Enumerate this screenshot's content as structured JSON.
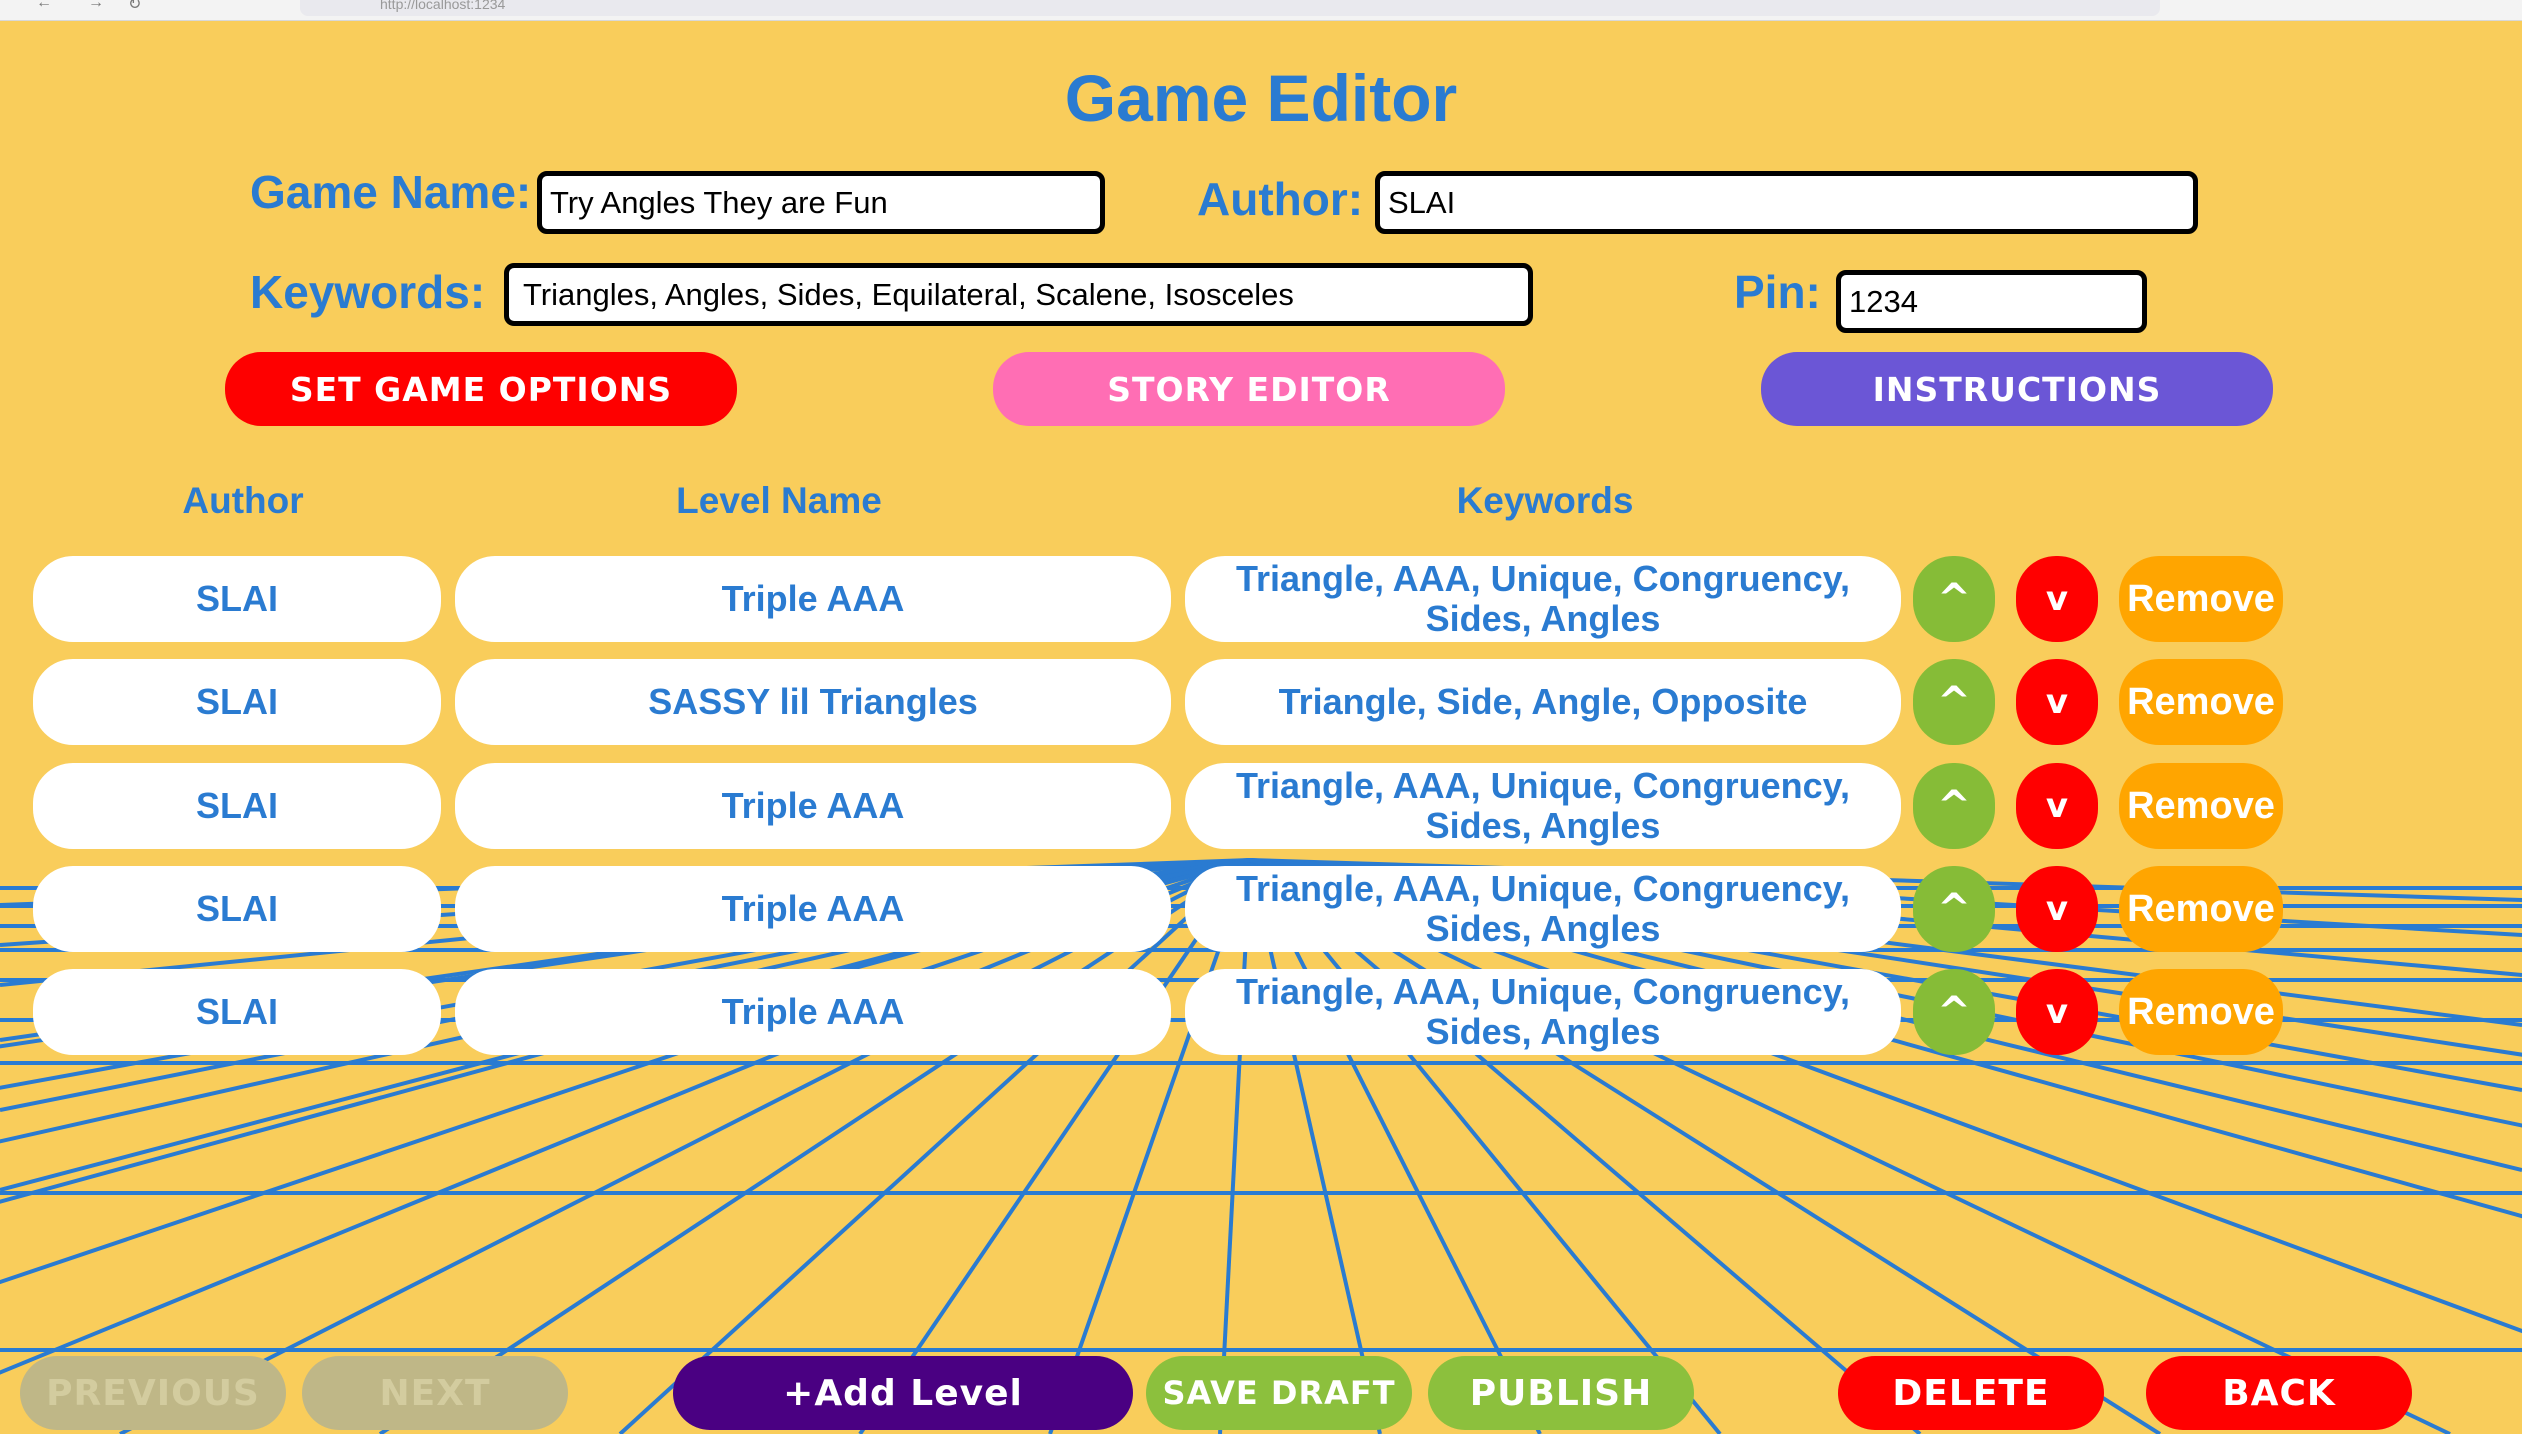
{
  "browser": {
    "url": "http://localhost:1234"
  },
  "page": {
    "title": "Game Editor"
  },
  "form": {
    "game_name_label": "Game Name:",
    "game_name_value": "Try Angles They are Fun",
    "author_label": "Author:",
    "author_value": "SLAI",
    "keywords_label": "Keywords:",
    "keywords_value": "Triangles, Angles, Sides, Equilateral, Scalene, Isosceles",
    "pin_label": "Pin:",
    "pin_value": "1234"
  },
  "actions": {
    "set_game_options": "SET GAME OPTIONS",
    "story_editor": "STORY EDITOR",
    "instructions": "INSTRUCTIONS"
  },
  "table": {
    "headers": {
      "author": "Author",
      "level_name": "Level Name",
      "keywords": "Keywords"
    },
    "rows": [
      {
        "author": "SLAI",
        "level_name": "Triple AAA",
        "keywords": "Triangle, AAA, Unique, Congruency, Sides, Angles"
      },
      {
        "author": "SLAI",
        "level_name": "SASSY lil Triangles",
        "keywords": "Triangle, Side, Angle, Opposite"
      },
      {
        "author": "SLAI",
        "level_name": "Triple AAA",
        "keywords": "Triangle, AAA, Unique, Congruency, Sides, Angles"
      },
      {
        "author": "SLAI",
        "level_name": "Triple AAA",
        "keywords": "Triangle, AAA, Unique, Congruency, Sides, Angles"
      },
      {
        "author": "SLAI",
        "level_name": "Triple AAA",
        "keywords": "Triangle, AAA, Unique, Congruency, Sides, Angles"
      }
    ],
    "row_buttons": {
      "up": "^",
      "down": "v",
      "remove": "Remove"
    }
  },
  "footer": {
    "previous": "PREVIOUS",
    "next": "NEXT",
    "add_level": "+Add Level",
    "save_draft": "SAVE DRAFT",
    "publish": "PUBLISH",
    "delete": "DELETE",
    "back": "BACK"
  },
  "colors": {
    "background": "#f9cd5b",
    "primary_text": "#2a7bd1",
    "grid_lines": "#2a7bd1",
    "set_options": "#fe0000",
    "story_editor": "#ff6eb4",
    "instructions": "#6b56d6",
    "move_up": "#86bc37",
    "move_down": "#ff0000",
    "remove": "#ffa500",
    "add_level": "#4a0082",
    "save_publish": "#8cc03d",
    "delete_back": "#ff0000"
  }
}
